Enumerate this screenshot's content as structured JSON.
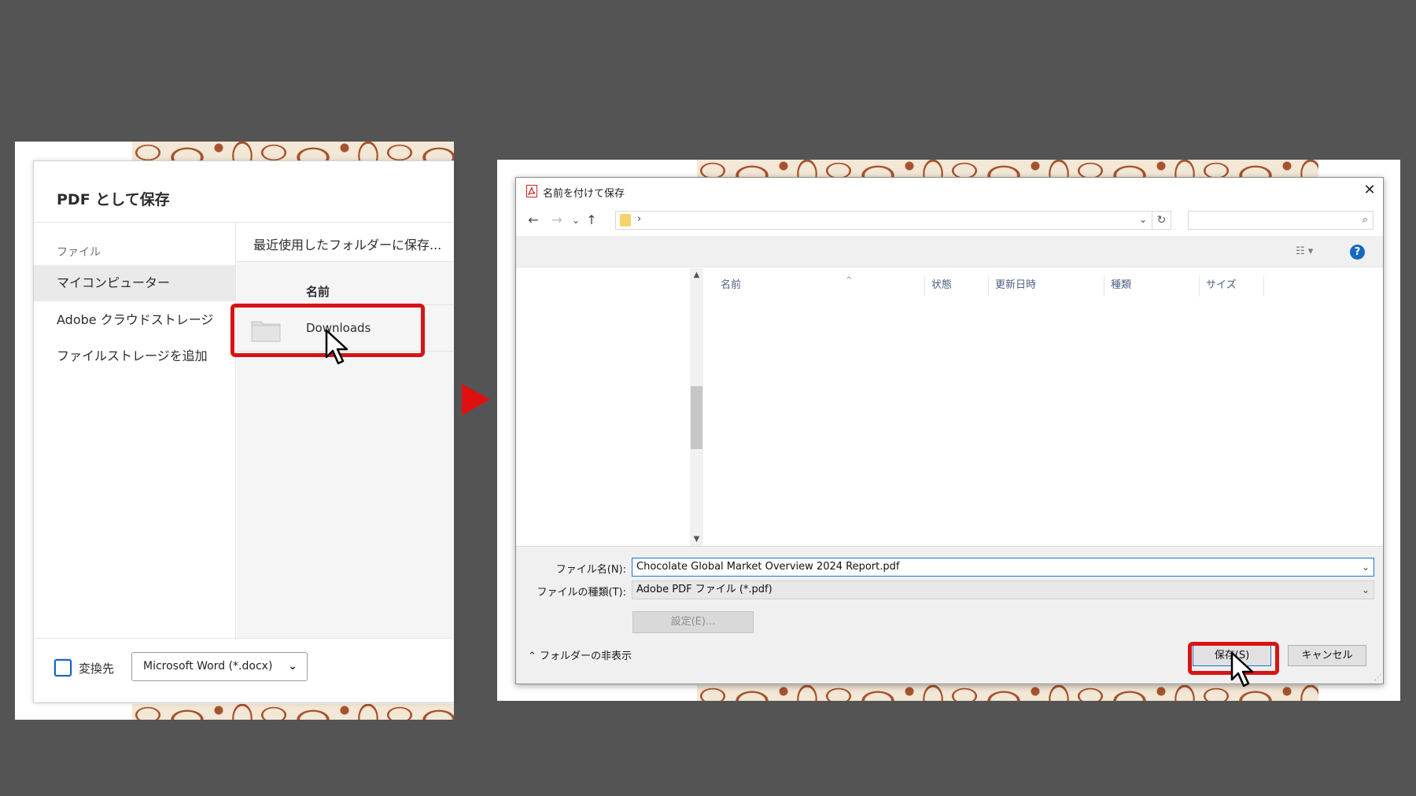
{
  "left_panel": {
    "title": "PDF として保存",
    "sidebar": {
      "heading": "ファイル",
      "items": [
        {
          "label": "マイコンピューター",
          "active": true
        },
        {
          "label": "Adobe クラウドストレージ",
          "active": false
        },
        {
          "label": "ファイルストレージを追加",
          "active": false
        }
      ]
    },
    "recent_folder_label": "最近使用したフォルダーに保存...",
    "column_header": "名前",
    "rows": [
      {
        "name": "Downloads",
        "icon": "folder-icon"
      }
    ],
    "convert_label": "変換先",
    "convert_checked": false,
    "format_value": "Microsoft Word (*.docx)"
  },
  "right_panel": {
    "title": "名前を付けて保存",
    "nav": {
      "back": "←",
      "forward": "→",
      "recent": "⌄",
      "up": "↑",
      "refresh": "↻"
    },
    "address_separator": "›",
    "columns": [
      "名前",
      "状態",
      "更新日時",
      "種類",
      "サイズ"
    ],
    "filename_label": "ファイル名(N):",
    "filename_value": "Chocolate Global Market Overview 2024 Report.pdf",
    "filetype_label": "ファイルの種類(T):",
    "filetype_value": "Adobe PDF ファイル (*.pdf)",
    "settings_button": "設定(E)...",
    "hide_folders_label": "フォルダーの非表示",
    "save_button": "保存(S)",
    "cancel_button": "キャンセル",
    "help": "?"
  },
  "colors": {
    "highlight": "#d71414",
    "background": "#545454",
    "accent": "#1a73d1",
    "floral": "#a24c24"
  }
}
